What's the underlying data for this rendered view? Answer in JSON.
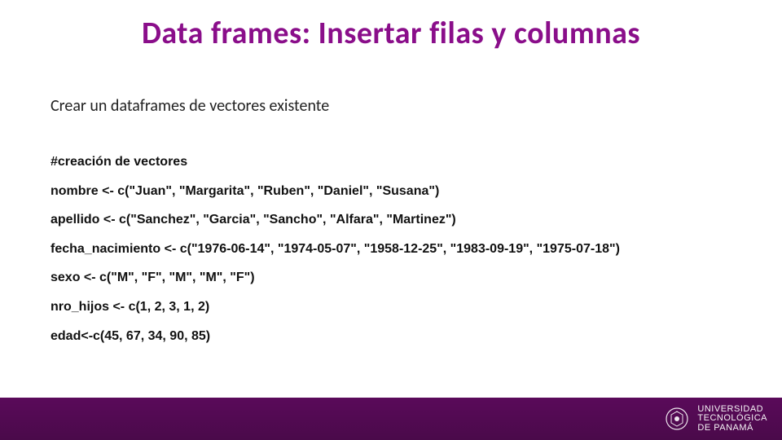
{
  "title": "Data frames: Insertar filas y columnas",
  "subtitle": "Crear un dataframes de vectores existente",
  "code": {
    "comment": "#creación de vectores",
    "lines": [
      "nombre <- c(\"Juan\", \"Margarita\", \"Ruben\", \"Daniel\", \"Susana\")",
      "apellido <- c(\"Sanchez\", \"Garcia\", \"Sancho\", \"Alfara\", \"Martinez\")",
      "fecha_nacimiento <- c(\"1976-06-14\", \"1974-05-07\", \"1958-12-25\", \"1983-09-19\", \"1975-07-18\")",
      "sexo <- c(\"M\", \"F\", \"M\", \"M\", \"F\")",
      "nro_hijos <- c(1, 2, 3, 1, 2)",
      "edad<-c(45, 67, 34, 90, 85)"
    ]
  },
  "footer": {
    "logo_name": "utp-logo",
    "org_line1": "UNIVERSIDAD",
    "org_line2": "TECNOLÓGICA",
    "org_line3": "DE PANAMÁ"
  },
  "colors": {
    "accent": "#8a0e8a",
    "footer_bg": "#4a0a4a"
  }
}
